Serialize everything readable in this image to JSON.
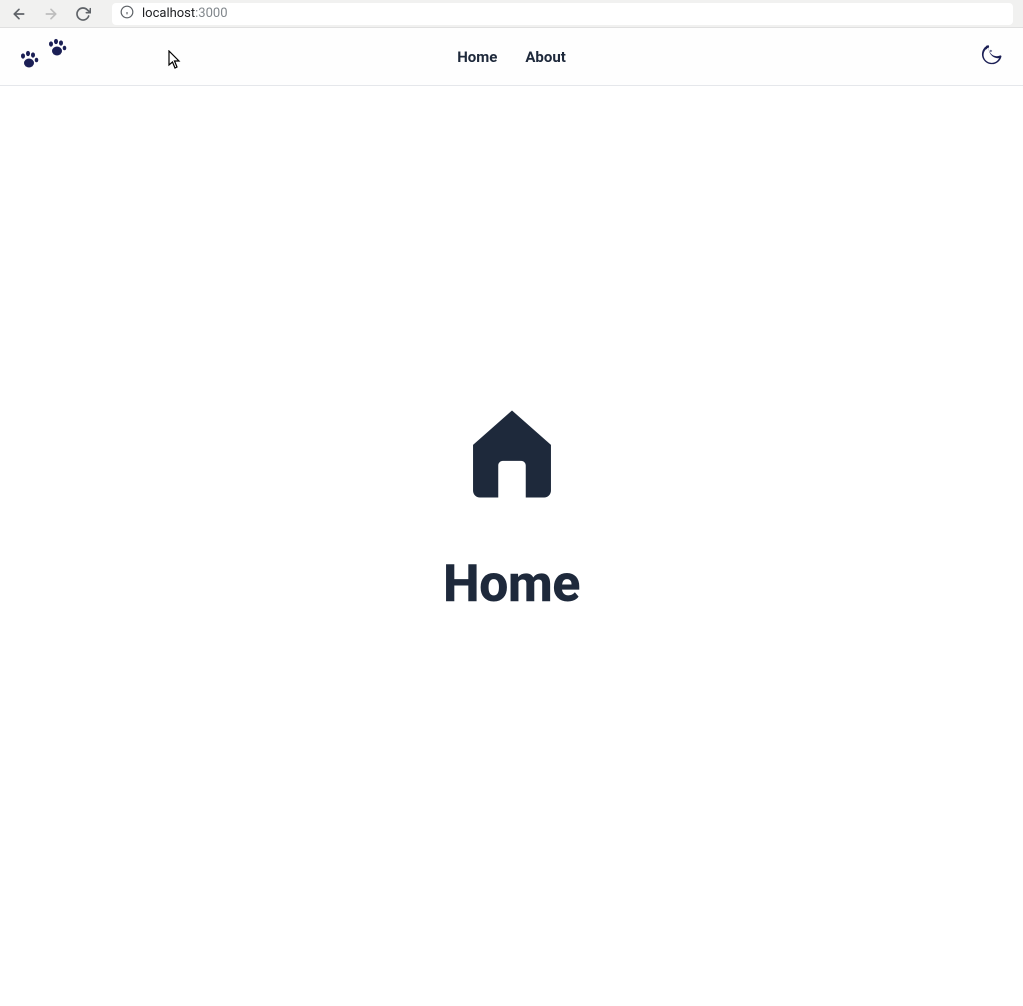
{
  "browser": {
    "url_host": "localhost",
    "url_port": ":3000"
  },
  "nav": {
    "links": [
      {
        "label": "Home"
      },
      {
        "label": "About"
      }
    ]
  },
  "hero": {
    "title": "Home"
  },
  "colors": {
    "brand": "#1b1f55",
    "text": "#1e293b"
  }
}
